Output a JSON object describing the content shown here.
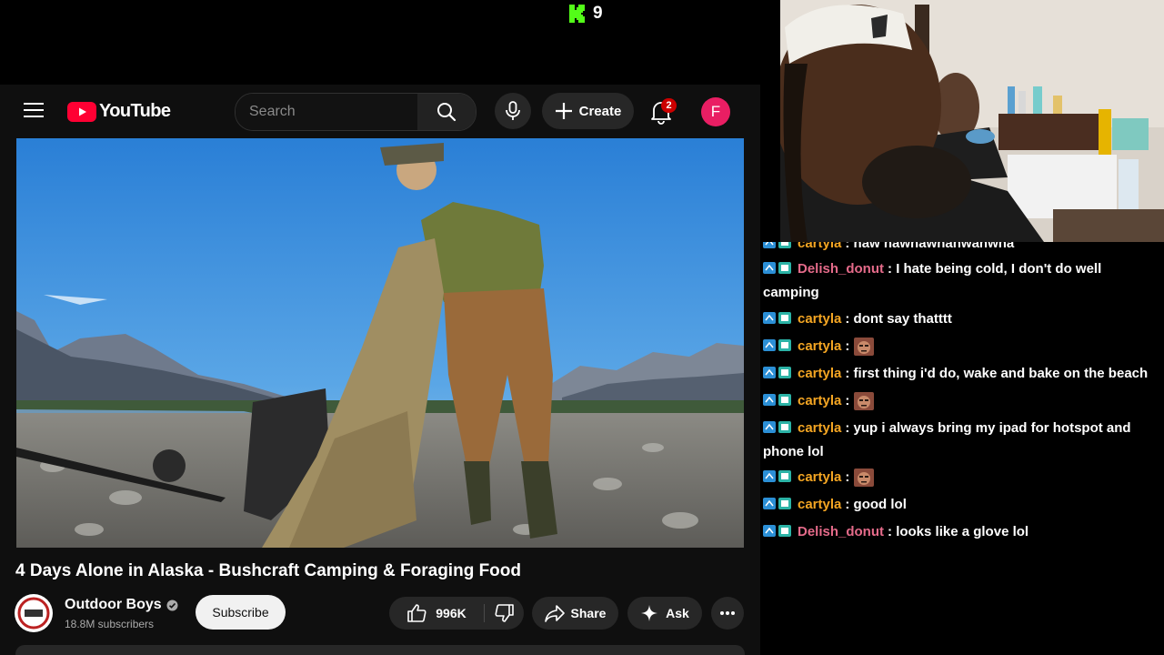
{
  "kick": {
    "viewer_count": "9"
  },
  "youtube": {
    "logo_text": "YouTube",
    "search": {
      "placeholder": "Search"
    },
    "create_label": "Create",
    "notifications_count": "2",
    "avatar_letter": "F",
    "video": {
      "title": "4 Days Alone in Alaska - Bushcraft Camping & Foraging Food",
      "channel_name": "Outdoor Boys",
      "subscribers": "18.8M subscribers",
      "subscribe_label": "Subscribe",
      "likes": "996K",
      "share_label": "Share",
      "ask_label": "Ask"
    }
  },
  "chat": {
    "messages": [
      {
        "user": "cartyla",
        "color": "#f5a623",
        "text": "naw nawnawnanwanwna"
      },
      {
        "user": "Delish_donut",
        "color": "#e56b8a",
        "text": "I hate being cold, I don't do well camping"
      },
      {
        "user": "cartyla",
        "color": "#f5a623",
        "text": "dont say thatttt"
      },
      {
        "user": "cartyla",
        "color": "#f5a623",
        "text": "",
        "emote": "emote-face"
      },
      {
        "user": "cartyla",
        "color": "#f5a623",
        "text": "first thing i'd do, wake and bake on the beach"
      },
      {
        "user": "cartyla",
        "color": "#f5a623",
        "text": "",
        "emote": "emote-face"
      },
      {
        "user": "cartyla",
        "color": "#f5a623",
        "text": "yup i always bring my ipad for hotspot and phone lol"
      },
      {
        "user": "cartyla",
        "color": "#f5a623",
        "text": "",
        "emote": "emote-face"
      },
      {
        "user": "cartyla",
        "color": "#f5a623",
        "text": "good lol"
      },
      {
        "user": "Delish_donut",
        "color": "#e56b8a",
        "text": "looks like a glove lol"
      }
    ]
  }
}
